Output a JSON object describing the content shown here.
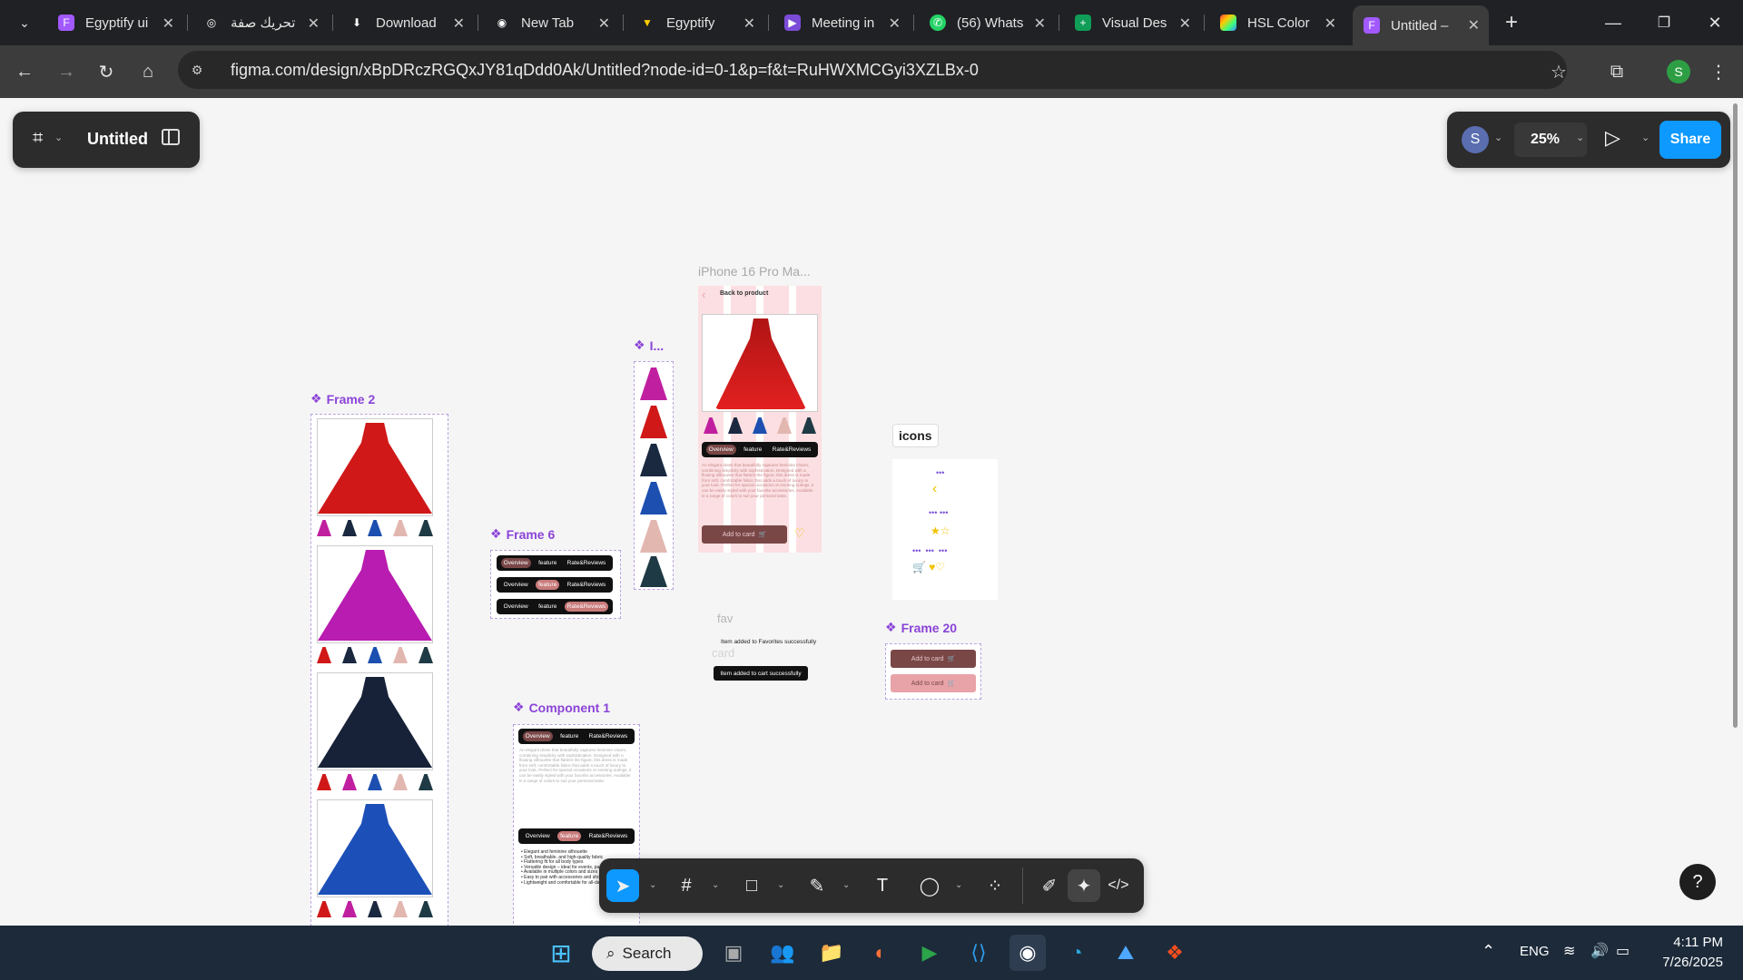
{
  "browser": {
    "tabs": [
      {
        "label": "Egyptify ui",
        "icon": "figma-icon",
        "color": "#a259ff"
      },
      {
        "label": "تحريك صفة",
        "icon": "chatgpt-icon",
        "color": "#ffffff"
      },
      {
        "label": "Download",
        "icon": "download-icon",
        "color": "#e3e3e3"
      },
      {
        "label": "New Tab",
        "icon": "chrome-icon",
        "color": "#ffffff"
      },
      {
        "label": "Egyptify",
        "icon": "vite-icon",
        "color": "#ffcc00"
      },
      {
        "label": "Meeting in",
        "icon": "meeting-icon",
        "color": "#7b4bd8"
      },
      {
        "label": "(56) Whats",
        "icon": "whatsapp-icon",
        "color": "#25d366"
      },
      {
        "label": "Visual Des",
        "icon": "sheets-icon",
        "color": "#0f9d58"
      },
      {
        "label": "HSL Color",
        "icon": "hsl-icon",
        "color": "#ff6a00"
      },
      {
        "label": "Untitled –",
        "icon": "figma-icon",
        "color": "#a259ff"
      }
    ],
    "url": "figma.com/design/xBpDRczRGQxJY81qDdd0Ak/Untitled?node-id=0-1&p=f&t=RuHWXMCGyi3XZLBx-0",
    "profile_initial": "S"
  },
  "figma": {
    "file_name": "Untitled",
    "user_initial": "S",
    "zoom": "25%",
    "share_label": "Share",
    "help_label": "?",
    "frames": {
      "frame2": "Frame 2",
      "frame6": "Frame 6",
      "frameI": "I...",
      "iphone": "iPhone 16 Pro Ma...",
      "icons": "icons",
      "frame20": "Frame 20",
      "component1": "Component 1"
    },
    "tabs_overview": "Overview",
    "tabs_feature": "feature",
    "tabs_reviews": "Rate&Reviews",
    "back_to_product": "Back to product",
    "add_to_card": "Add to card",
    "fav_label": "fav",
    "card_label": "card",
    "fav_toast": "Item added to Favorites successfully",
    "cart_toast": "Item added to cart successfully",
    "description": "An elegant dress that beautifully captures feminine charm, combining simplicity with sophistication. Designed with a flowing silhouette that flatters the figure, this dress is made from soft, comfortable fabric that adds a touch of luxury to your look. Perfect for special occasions or evening outings, it can be easily styled with your favorite accessories. Available in a range of colors to suit your personal taste.",
    "features": [
      "• Elegant and feminine silhouette",
      "• Soft, breathable, and high-quality fabric",
      "• Flattering fit for all body types",
      "• Versatile design – ideal for events, parties",
      "• Available in multiple colors and sizes",
      "• Easy to pair with accessories and shoes",
      "• Lightweight and comfortable for all-day wear"
    ]
  },
  "taskbar": {
    "search_label": "Search",
    "language": "ENG",
    "time": "4:11 PM",
    "date": "7/26/2025"
  },
  "colors": {
    "accent": "#0d99ff",
    "frame_label": "#8b44d8",
    "pill_brown": "#7a4747",
    "pill_pink": "#e8a3a8",
    "star": "#f2c200"
  }
}
